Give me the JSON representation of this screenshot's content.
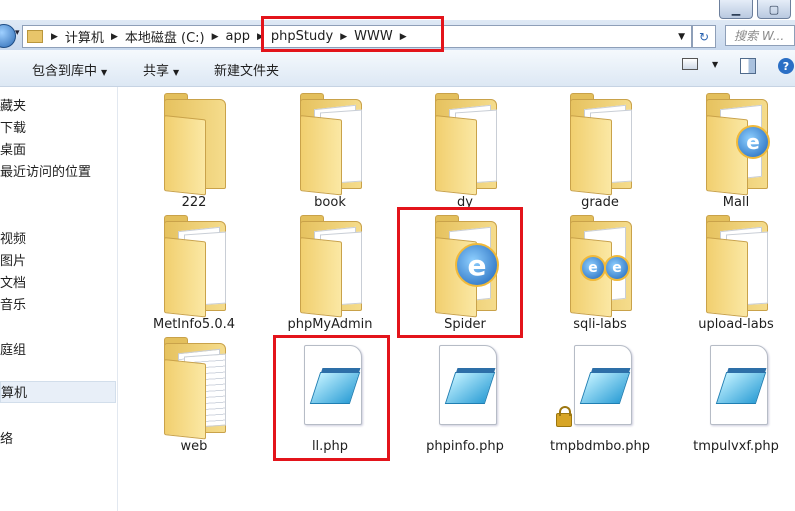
{
  "address_bar": {
    "segments": [
      "计算机",
      "本地磁盘 (C:)",
      "app",
      "phpStudy",
      "WWW"
    ]
  },
  "search": {
    "placeholder": "搜索 W..."
  },
  "toolbar": {
    "include_library": "包含到库中",
    "share": "共享",
    "new_folder": "新建文件夹"
  },
  "sidebar": {
    "items": [
      "藏夹",
      "下载",
      "桌面",
      "最近访问的位置",
      "视频",
      "图片",
      "文档",
      "音乐",
      "庭组",
      "算机",
      "络"
    ],
    "selected": "算机"
  },
  "files": [
    {
      "name": "222",
      "type": "folder"
    },
    {
      "name": "book",
      "type": "folder"
    },
    {
      "name": "dy",
      "type": "folder"
    },
    {
      "name": "grade",
      "type": "folder"
    },
    {
      "name": "Mall",
      "type": "folder-ie"
    },
    {
      "name": "MetInfo5.0.4",
      "type": "folder"
    },
    {
      "name": "phpMyAdmin",
      "type": "folder"
    },
    {
      "name": "Spider",
      "type": "folder-ie"
    },
    {
      "name": "sqli-labs",
      "type": "folder-ie"
    },
    {
      "name": "upload-labs",
      "type": "folder"
    },
    {
      "name": "web",
      "type": "folder"
    },
    {
      "name": "ll.php",
      "type": "php-file"
    },
    {
      "name": "phpinfo.php",
      "type": "php-file"
    },
    {
      "name": "tmpbdmbo.php",
      "type": "php-file-locked"
    },
    {
      "name": "tmpulvxf.php",
      "type": "php-file"
    }
  ],
  "annotation_color": "#e3141b"
}
